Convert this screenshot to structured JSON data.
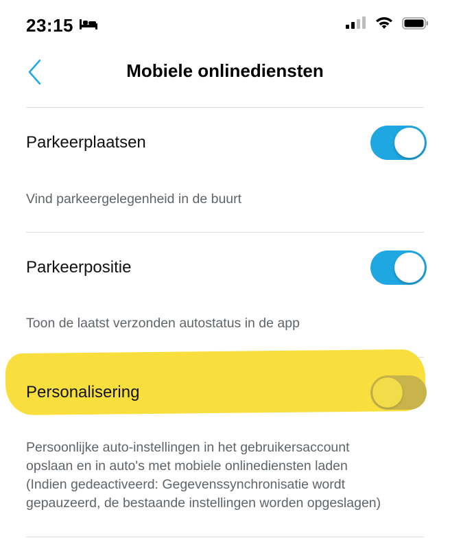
{
  "status_bar": {
    "time": "23:15",
    "icons": [
      "sleep-bed-icon",
      "signal-icon",
      "wifi-icon",
      "battery-icon"
    ]
  },
  "nav": {
    "title": "Mobiele onlinediensten",
    "back_icon": "chevron-left-icon"
  },
  "settings": [
    {
      "label": "Parkeerplaatsen",
      "description": "Vind parkeergelegenheid in de buurt",
      "enabled": true
    },
    {
      "label": "Parkeerpositie",
      "description": "Toon de laatst verzonden autostatus in de app",
      "enabled": true
    },
    {
      "label": "Personalisering",
      "description_lines": [
        "Persoonlijke auto-instellingen in het gebruikersaccount",
        "opslaan en in auto's met mobiele onlinediensten laden",
        "(Indien gedeactiveerd: Gegevenssynchronisatie wordt",
        "gepauzeerd, de bestaande instellingen worden opgeslagen)"
      ],
      "enabled": false,
      "highlighted": true
    }
  ],
  "colors": {
    "accent": "#1ea7e1",
    "highlight": "#f8df3e",
    "description_text": "#5f6468",
    "divider": "#dcdcdc"
  }
}
